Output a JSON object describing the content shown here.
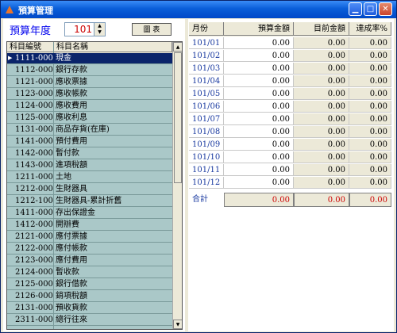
{
  "window": {
    "title": "預算管理",
    "icon": "app-icon"
  },
  "controls": {
    "year_label": "預算年度",
    "year_value": "101",
    "report_button": "圖 表"
  },
  "accounts": {
    "headers": [
      "科目編號",
      "科目名稱"
    ],
    "selected_index": 0,
    "rows": [
      {
        "code": "1111-000",
        "name": "現金"
      },
      {
        "code": "1112-000",
        "name": "銀行存款"
      },
      {
        "code": "1121-000",
        "name": "應收票據"
      },
      {
        "code": "1123-000",
        "name": "應收帳款"
      },
      {
        "code": "1124-000",
        "name": "應收費用"
      },
      {
        "code": "1125-000",
        "name": "應收利息"
      },
      {
        "code": "1131-000",
        "name": "商品存貨(在庫)"
      },
      {
        "code": "1141-000",
        "name": "預付費用"
      },
      {
        "code": "1142-000",
        "name": "暫付款"
      },
      {
        "code": "1143-000",
        "name": "進項稅額"
      },
      {
        "code": "1211-000",
        "name": "土地"
      },
      {
        "code": "1212-000",
        "name": "生財器具"
      },
      {
        "code": "1212-100",
        "name": "生財器具-累計折舊"
      },
      {
        "code": "1411-000",
        "name": "存出保證金"
      },
      {
        "code": "1412-000",
        "name": "開辦費"
      },
      {
        "code": "2121-000",
        "name": "應付票據"
      },
      {
        "code": "2122-000",
        "name": "應付帳款"
      },
      {
        "code": "2123-000",
        "name": "應付費用"
      },
      {
        "code": "2124-000",
        "name": "暫收款"
      },
      {
        "code": "2125-000",
        "name": "銀行借款"
      },
      {
        "code": "2126-000",
        "name": "銷項稅額"
      },
      {
        "code": "2131-000",
        "name": "預收貨款"
      },
      {
        "code": "2311-000",
        "name": "總行往來"
      }
    ]
  },
  "budget": {
    "headers": {
      "month": "月份",
      "budget": "預算金額",
      "current": "目前金額",
      "rate": "達成率%"
    },
    "rows": [
      {
        "month": "101/01",
        "budget": "0.00",
        "current": "0.00",
        "rate": "0.00"
      },
      {
        "month": "101/02",
        "budget": "0.00",
        "current": "0.00",
        "rate": "0.00"
      },
      {
        "month": "101/03",
        "budget": "0.00",
        "current": "0.00",
        "rate": "0.00"
      },
      {
        "month": "101/04",
        "budget": "0.00",
        "current": "0.00",
        "rate": "0.00"
      },
      {
        "month": "101/05",
        "budget": "0.00",
        "current": "0.00",
        "rate": "0.00"
      },
      {
        "month": "101/06",
        "budget": "0.00",
        "current": "0.00",
        "rate": "0.00"
      },
      {
        "month": "101/07",
        "budget": "0.00",
        "current": "0.00",
        "rate": "0.00"
      },
      {
        "month": "101/08",
        "budget": "0.00",
        "current": "0.00",
        "rate": "0.00"
      },
      {
        "month": "101/09",
        "budget": "0.00",
        "current": "0.00",
        "rate": "0.00"
      },
      {
        "month": "101/10",
        "budget": "0.00",
        "current": "0.00",
        "rate": "0.00"
      },
      {
        "month": "101/11",
        "budget": "0.00",
        "current": "0.00",
        "rate": "0.00"
      },
      {
        "month": "101/12",
        "budget": "0.00",
        "current": "0.00",
        "rate": "0.00"
      }
    ],
    "total": {
      "label": "合計",
      "budget": "0.00",
      "current": "0.00",
      "rate": "0.00"
    }
  },
  "colors": {
    "title_bar": "#0a5ed8",
    "selection": "#0a246a",
    "list_bg": "#aac8c8",
    "total_text": "#cc0000"
  }
}
